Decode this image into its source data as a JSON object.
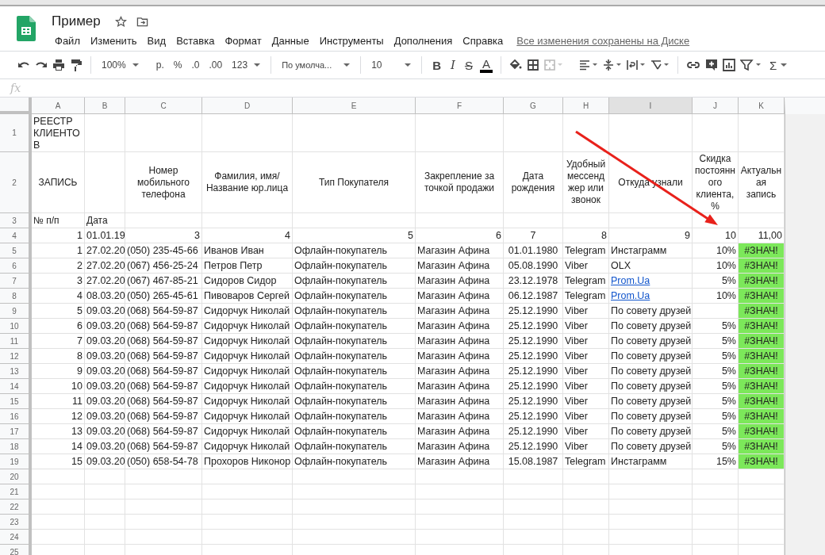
{
  "doc": {
    "title": "Пример",
    "saved_status": "Все изменения сохранены на Диске"
  },
  "menu": [
    "Файл",
    "Изменить",
    "Вид",
    "Вставка",
    "Формат",
    "Данные",
    "Инструменты",
    "Дополнения",
    "Справка"
  ],
  "toolbar": {
    "zoom": "100%",
    "currency": "р.",
    "percent": "%",
    "dec_less": ".0",
    "dec_more": ".00",
    "number_format": "123",
    "font": "По умолча...",
    "font_size": "10",
    "bold": "B",
    "italic": "I",
    "strike": "S",
    "text_color": "A",
    "sum": "Σ"
  },
  "formula_bar": {
    "label": "fx"
  },
  "columns": [
    {
      "letter": "A",
      "selected": false
    },
    {
      "letter": "B",
      "selected": false
    },
    {
      "letter": "C",
      "selected": false
    },
    {
      "letter": "D",
      "selected": false
    },
    {
      "letter": "E",
      "selected": false
    },
    {
      "letter": "F",
      "selected": false
    },
    {
      "letter": "G",
      "selected": false
    },
    {
      "letter": "H",
      "selected": false
    },
    {
      "letter": "I",
      "selected": true
    },
    {
      "letter": "J",
      "selected": false
    },
    {
      "letter": "K",
      "selected": false
    }
  ],
  "rows": [
    {
      "n": "1",
      "kind": "title",
      "cells": [
        "РЕЕСТР КЛИЕНТОВ",
        null,
        null,
        null,
        null,
        null,
        null,
        null,
        null,
        null,
        null
      ]
    },
    {
      "n": "2",
      "kind": "header",
      "cells": [
        "ЗАПИСЬ",
        null,
        "Номер мобильного телефона",
        "Фамилия, имя/ Название юр.лица",
        "Тип Покупателя",
        "Закрепление за точкой продажи",
        "Дата рождения",
        "Удобный мессенджер или звонок",
        "Откуда узнали",
        "Скидка постоянного клиента, %",
        "Актуальная запись"
      ]
    },
    {
      "n": "3",
      "kind": "label",
      "cells": [
        "№ п/п",
        "Дата",
        null,
        null,
        null,
        null,
        null,
        null,
        null,
        null,
        null
      ]
    },
    {
      "n": "4",
      "kind": "numbers",
      "cells": [
        "1",
        "01.01.19",
        "3",
        "4",
        "5",
        "6",
        "7",
        "8",
        "9",
        "10",
        "11,00"
      ]
    },
    {
      "n": "5",
      "kind": "data",
      "link": false,
      "highlighted": true,
      "cells": [
        "1",
        "27.02.20",
        "(050) 235-45-66",
        "Иванов Иван",
        "Офлайн-покупатель",
        "Магазин Афина",
        "01.01.1980",
        "Telegram",
        "Инстаграмм",
        "10%",
        "#ЗНАЧ!"
      ]
    },
    {
      "n": "6",
      "kind": "data",
      "link": false,
      "highlighted": true,
      "cells": [
        "2",
        "27.02.20",
        "(067) 456-25-24",
        "Петров Петр",
        "Офлайн-покупатель",
        "Магазин Афина",
        "05.08.1990",
        "Viber",
        "OLX",
        "10%",
        "#ЗНАЧ!"
      ]
    },
    {
      "n": "7",
      "kind": "data",
      "link": true,
      "highlighted": true,
      "cells": [
        "3",
        "27.02.20",
        "(067) 467-85-21",
        "Сидоров Сидор",
        "Офлайн-покупатель",
        "Магазин Афина",
        "23.12.1978",
        "Telegram",
        "Prom.Ua",
        "5%",
        "#ЗНАЧ!"
      ]
    },
    {
      "n": "8",
      "kind": "data",
      "link": true,
      "highlighted": true,
      "cells": [
        "4",
        "08.03.20",
        "(050) 265-45-61",
        "Пивоваров Сергей",
        "Офлайн-покупатель",
        "Магазин Афина",
        "06.12.1987",
        "Telegram",
        "Prom.Ua",
        "10%",
        "#ЗНАЧ!"
      ]
    },
    {
      "n": "9",
      "kind": "data",
      "link": false,
      "highlighted": true,
      "cells": [
        "5",
        "09.03.20",
        "(068) 564-59-87",
        "Сидорчук Николай",
        "Офлайн-покупатель",
        "Магазин Афина",
        "25.12.1990",
        "Viber",
        "По совету друзей",
        null,
        "#ЗНАЧ!"
      ]
    },
    {
      "n": "10",
      "kind": "data",
      "link": false,
      "highlighted": true,
      "cells": [
        "6",
        "09.03.20",
        "(068) 564-59-87",
        "Сидорчук Николай",
        "Офлайн-покупатель",
        "Магазин Афина",
        "25.12.1990",
        "Viber",
        "По совету друзей",
        "5%",
        "#ЗНАЧ!"
      ]
    },
    {
      "n": "11",
      "kind": "data",
      "link": false,
      "highlighted": true,
      "cells": [
        "7",
        "09.03.20",
        "(068) 564-59-87",
        "Сидорчук Николай",
        "Офлайн-покупатель",
        "Магазин Афина",
        "25.12.1990",
        "Viber",
        "По совету друзей",
        "5%",
        "#ЗНАЧ!"
      ]
    },
    {
      "n": "12",
      "kind": "data",
      "link": false,
      "highlighted": true,
      "cells": [
        "8",
        "09.03.20",
        "(068) 564-59-87",
        "Сидорчук Николай",
        "Офлайн-покупатель",
        "Магазин Афина",
        "25.12.1990",
        "Viber",
        "По совету друзей",
        "5%",
        "#ЗНАЧ!"
      ]
    },
    {
      "n": "13",
      "kind": "data",
      "link": false,
      "highlighted": true,
      "cells": [
        "9",
        "09.03.20",
        "(068) 564-59-87",
        "Сидорчук Николай",
        "Офлайн-покупатель",
        "Магазин Афина",
        "25.12.1990",
        "Viber",
        "По совету друзей",
        "5%",
        "#ЗНАЧ!"
      ]
    },
    {
      "n": "14",
      "kind": "data",
      "link": false,
      "highlighted": true,
      "cells": [
        "10",
        "09.03.20",
        "(068) 564-59-87",
        "Сидорчук Николай",
        "Офлайн-покупатель",
        "Магазин Афина",
        "25.12.1990",
        "Viber",
        "По совету друзей",
        "5%",
        "#ЗНАЧ!"
      ]
    },
    {
      "n": "15",
      "kind": "data",
      "link": false,
      "highlighted": true,
      "cells": [
        "11",
        "09.03.20",
        "(068) 564-59-87",
        "Сидорчук Николай",
        "Офлайн-покупатель",
        "Магазин Афина",
        "25.12.1990",
        "Viber",
        "По совету друзей",
        "5%",
        "#ЗНАЧ!"
      ]
    },
    {
      "n": "16",
      "kind": "data",
      "link": false,
      "highlighted": true,
      "cells": [
        "12",
        "09.03.20",
        "(068) 564-59-87",
        "Сидорчук Николай",
        "Офлайн-покупатель",
        "Магазин Афина",
        "25.12.1990",
        "Viber",
        "По совету друзей",
        "5%",
        "#ЗНАЧ!"
      ]
    },
    {
      "n": "17",
      "kind": "data",
      "link": false,
      "highlighted": true,
      "cells": [
        "13",
        "09.03.20",
        "(068) 564-59-87",
        "Сидорчук Николай",
        "Офлайн-покупатель",
        "Магазин Афина",
        "25.12.1990",
        "Viber",
        "По совету друзей",
        "5%",
        "#ЗНАЧ!"
      ]
    },
    {
      "n": "18",
      "kind": "data",
      "link": false,
      "highlighted": true,
      "cells": [
        "14",
        "09.03.20",
        "(068) 564-59-87",
        "Сидорчук Николай",
        "Офлайн-покупатель",
        "Магазин Афина",
        "25.12.1990",
        "Viber",
        "По совету друзей",
        "5%",
        "#ЗНАЧ!"
      ]
    },
    {
      "n": "19",
      "kind": "data",
      "link": false,
      "highlighted": true,
      "cells": [
        "15",
        "09.03.20",
        "(050) 658-54-78",
        "Прохоров Никонор",
        "Офлайн-покупатель",
        "Магазин Афина",
        "15.08.1987",
        "Telegram",
        "Инстаграмм",
        "15%",
        "#ЗНАЧ!"
      ]
    },
    {
      "n": "20",
      "kind": "empty",
      "cells": [
        null,
        null,
        null,
        null,
        null,
        null,
        null,
        null,
        null,
        null,
        null
      ]
    },
    {
      "n": "21",
      "kind": "empty",
      "cells": [
        null,
        null,
        null,
        null,
        null,
        null,
        null,
        null,
        null,
        null,
        null
      ]
    },
    {
      "n": "22",
      "kind": "empty",
      "cells": [
        null,
        null,
        null,
        null,
        null,
        null,
        null,
        null,
        null,
        null,
        null
      ]
    },
    {
      "n": "23",
      "kind": "empty",
      "cells": [
        null,
        null,
        null,
        null,
        null,
        null,
        null,
        null,
        null,
        null,
        null
      ]
    },
    {
      "n": "24",
      "kind": "empty",
      "cells": [
        null,
        null,
        null,
        null,
        null,
        null,
        null,
        null,
        null,
        null,
        null
      ]
    },
    {
      "n": "25",
      "kind": "empty",
      "cells": [
        null,
        null,
        null,
        null,
        null,
        null,
        null,
        null,
        null,
        null,
        null
      ]
    }
  ]
}
